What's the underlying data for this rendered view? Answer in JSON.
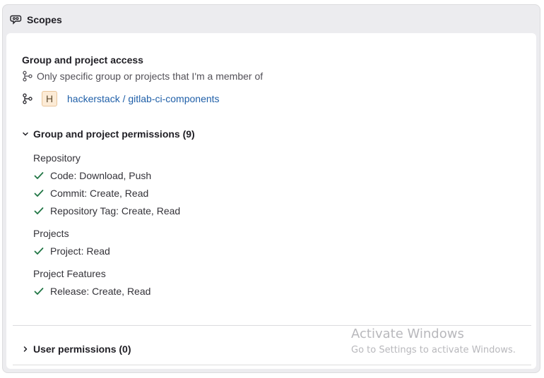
{
  "header": {
    "title": "Scopes",
    "icon": "scopes-icon"
  },
  "access": {
    "title": "Group and project access",
    "description": "Only specific group or projects that I'm a member of",
    "icon": "group-branch-icon"
  },
  "project": {
    "avatar_letter": "H",
    "name": "hackerstack / gitlab-ci-components",
    "link_color": "#1f5fa8"
  },
  "group_permissions": {
    "label": "Group and project permissions (9)",
    "expanded": true,
    "categories": [
      {
        "title": "Repository",
        "items": [
          "Code: Download, Push",
          "Commit: Create, Read",
          "Repository Tag: Create, Read"
        ]
      },
      {
        "title": "Projects",
        "items": [
          "Project: Read"
        ]
      },
      {
        "title": "Project Features",
        "items": [
          "Release: Create, Read"
        ]
      }
    ]
  },
  "user_permissions": {
    "label": "User permissions (0)",
    "expanded": false
  },
  "watermark": {
    "line1": "Activate Windows",
    "line2": "Go to Settings to activate Windows."
  },
  "colors": {
    "check": "#217645",
    "header_bg": "#ececef",
    "link": "#1f5fa8"
  }
}
